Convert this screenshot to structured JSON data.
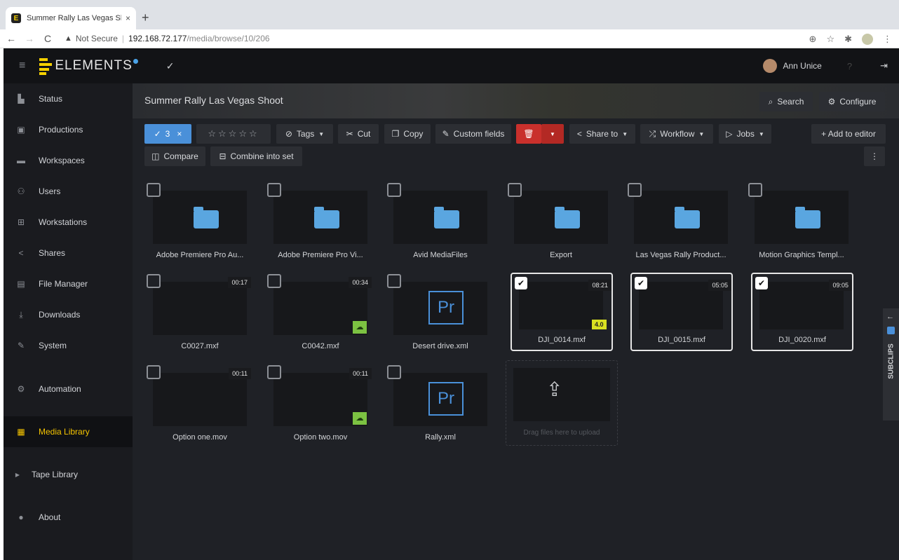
{
  "browser": {
    "tab_title": "Summer Rally Las Vegas Shoo",
    "tab_close": "×",
    "new_tab": "+",
    "not_secure": "Not Secure",
    "host": "192.168.72.177",
    "path": "/media/browse/10/206"
  },
  "header": {
    "logo_text": "ELEMENTS",
    "user_name": "Ann Unice",
    "help": "?"
  },
  "sidebar": {
    "items": [
      {
        "label": "Status",
        "icon": "status-icon"
      },
      {
        "label": "Productions",
        "icon": "productions-icon"
      },
      {
        "label": "Workspaces",
        "icon": "workspaces-icon"
      },
      {
        "label": "Users",
        "icon": "users-icon"
      },
      {
        "label": "Workstations",
        "icon": "workstations-icon"
      },
      {
        "label": "Shares",
        "icon": "shares-icon"
      },
      {
        "label": "File Manager",
        "icon": "file-manager-icon"
      },
      {
        "label": "Downloads",
        "icon": "downloads-icon"
      },
      {
        "label": "System",
        "icon": "system-icon"
      },
      {
        "label": "Automation",
        "icon": "automation-icon"
      },
      {
        "label": "Media Library",
        "icon": "media-library-icon"
      },
      {
        "label": "Tape Library",
        "icon": "expand-icon"
      },
      {
        "label": "About",
        "icon": "info-icon"
      }
    ],
    "active": "Media Library"
  },
  "page": {
    "title": "Summer Rally Las Vegas Shoot",
    "search": "Search",
    "configure": "Configure"
  },
  "toolbar": {
    "selected_count": "3",
    "close": "×",
    "stars": "☆☆☆☆☆",
    "tags": "Tags",
    "cut": "Cut",
    "copy": "Copy",
    "custom_fields": "Custom fields",
    "share_to": "Share to",
    "workflow": "Workflow",
    "jobs": "Jobs",
    "add_to_editor": "+ Add to editor",
    "compare": "Compare",
    "combine": "Combine into set"
  },
  "folders": [
    {
      "name": "Adobe Premiere Pro Au..."
    },
    {
      "name": "Adobe Premiere Pro Vi..."
    },
    {
      "name": "Avid MediaFiles"
    },
    {
      "name": "Export"
    },
    {
      "name": "Las Vegas Rally Product..."
    },
    {
      "name": "Motion Graphics Templ..."
    }
  ],
  "media": [
    {
      "name": "C0027.mxf",
      "duration": "00:17"
    },
    {
      "name": "C0042.mxf",
      "duration": "00:34"
    },
    {
      "name": "Desert drive.xml",
      "pr": "Pr"
    },
    {
      "name": "DJI_0014.mxf",
      "duration": "08:21",
      "rating": "4.0"
    },
    {
      "name": "DJI_0015.mxf",
      "duration": "05:05"
    },
    {
      "name": "DJI_0020.mxf",
      "duration": "09:05"
    },
    {
      "name": "Option one.mov",
      "duration": "00:11"
    },
    {
      "name": "Option two.mov",
      "duration": "00:11"
    },
    {
      "name": "Rally.xml",
      "pr": "Pr"
    }
  ],
  "upload": {
    "text": "Drag files here to upload"
  },
  "subclips": {
    "label": "SUBCLIPS"
  },
  "colors": {
    "accent": "#4a90d9",
    "active": "#f5c400",
    "danger": "#c9302c",
    "cloud": "#7cc242"
  }
}
